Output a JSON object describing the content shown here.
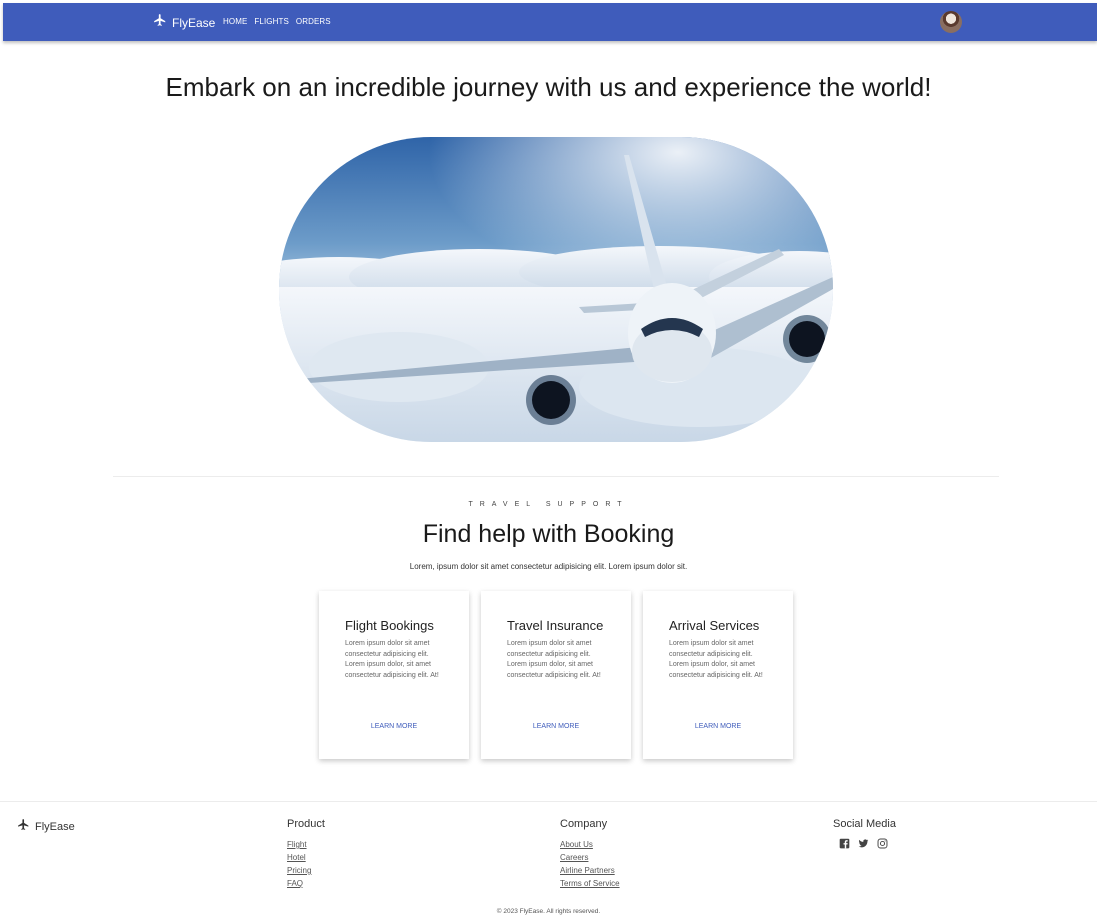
{
  "nav": {
    "brand": "FlyEase",
    "links": [
      "HOME",
      "FLIGHTS",
      "ORDERS"
    ]
  },
  "hero": {
    "title": "Embark on an incredible journey with us and experience the world!"
  },
  "support": {
    "eyebrow": "TRAVEL SUPPORT",
    "title": "Find help with Booking",
    "subtitle": "Lorem, ipsum dolor sit amet consectetur adipisicing elit. Lorem ipsum dolor sit.",
    "cards": [
      {
        "title": "Flight Bookings",
        "text": "Lorem ipsum dolor sit amet consectetur adipisicing elit. Lorem ipsum dolor, sit amet consectetur adipisicing elit. At!",
        "link": "LEARN MORE"
      },
      {
        "title": "Travel Insurance",
        "text": "Lorem ipsum dolor sit amet consectetur adipisicing elit. Lorem ipsum dolor, sit amet consectetur adipisicing elit. At!",
        "link": "LEARN MORE"
      },
      {
        "title": "Arrival Services",
        "text": "Lorem ipsum dolor sit amet consectetur adipisicing elit. Lorem ipsum dolor, sit amet consectetur adipisicing elit. At!",
        "link": "LEARN MORE"
      }
    ]
  },
  "footer": {
    "brand": "FlyEase",
    "product": {
      "heading": "Product",
      "links": [
        "Flight",
        "Hotel",
        "Pricing",
        "FAQ"
      ]
    },
    "company": {
      "heading": "Company",
      "links": [
        "About Us",
        "Careers",
        "Airline Partners",
        "Terms of Service"
      ]
    },
    "social": {
      "heading": "Social Media",
      "icons": [
        "facebook-icon",
        "twitter-icon",
        "instagram-icon"
      ]
    },
    "copyright": "© 2023 FlyEase. All rights reserved."
  },
  "colors": {
    "primary": "#3f5cbb"
  }
}
